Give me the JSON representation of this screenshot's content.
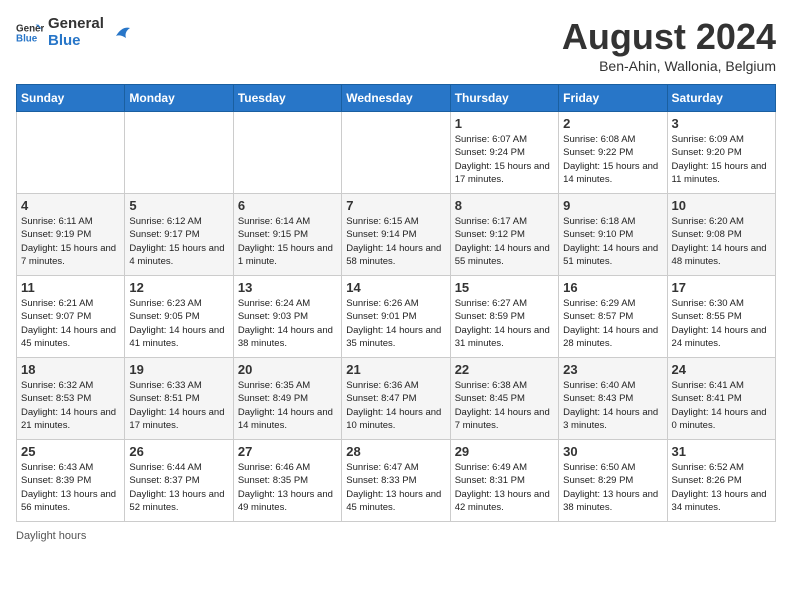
{
  "header": {
    "logo_line1": "General",
    "logo_line2": "Blue",
    "month_title": "August 2024",
    "subtitle": "Ben-Ahin, Wallonia, Belgium"
  },
  "days_of_week": [
    "Sunday",
    "Monday",
    "Tuesday",
    "Wednesday",
    "Thursday",
    "Friday",
    "Saturday"
  ],
  "weeks": [
    [
      {
        "day": "",
        "info": ""
      },
      {
        "day": "",
        "info": ""
      },
      {
        "day": "",
        "info": ""
      },
      {
        "day": "",
        "info": ""
      },
      {
        "day": "1",
        "info": "Sunrise: 6:07 AM\nSunset: 9:24 PM\nDaylight: 15 hours and 17 minutes."
      },
      {
        "day": "2",
        "info": "Sunrise: 6:08 AM\nSunset: 9:22 PM\nDaylight: 15 hours and 14 minutes."
      },
      {
        "day": "3",
        "info": "Sunrise: 6:09 AM\nSunset: 9:20 PM\nDaylight: 15 hours and 11 minutes."
      }
    ],
    [
      {
        "day": "4",
        "info": "Sunrise: 6:11 AM\nSunset: 9:19 PM\nDaylight: 15 hours and 7 minutes."
      },
      {
        "day": "5",
        "info": "Sunrise: 6:12 AM\nSunset: 9:17 PM\nDaylight: 15 hours and 4 minutes."
      },
      {
        "day": "6",
        "info": "Sunrise: 6:14 AM\nSunset: 9:15 PM\nDaylight: 15 hours and 1 minute."
      },
      {
        "day": "7",
        "info": "Sunrise: 6:15 AM\nSunset: 9:14 PM\nDaylight: 14 hours and 58 minutes."
      },
      {
        "day": "8",
        "info": "Sunrise: 6:17 AM\nSunset: 9:12 PM\nDaylight: 14 hours and 55 minutes."
      },
      {
        "day": "9",
        "info": "Sunrise: 6:18 AM\nSunset: 9:10 PM\nDaylight: 14 hours and 51 minutes."
      },
      {
        "day": "10",
        "info": "Sunrise: 6:20 AM\nSunset: 9:08 PM\nDaylight: 14 hours and 48 minutes."
      }
    ],
    [
      {
        "day": "11",
        "info": "Sunrise: 6:21 AM\nSunset: 9:07 PM\nDaylight: 14 hours and 45 minutes."
      },
      {
        "day": "12",
        "info": "Sunrise: 6:23 AM\nSunset: 9:05 PM\nDaylight: 14 hours and 41 minutes."
      },
      {
        "day": "13",
        "info": "Sunrise: 6:24 AM\nSunset: 9:03 PM\nDaylight: 14 hours and 38 minutes."
      },
      {
        "day": "14",
        "info": "Sunrise: 6:26 AM\nSunset: 9:01 PM\nDaylight: 14 hours and 35 minutes."
      },
      {
        "day": "15",
        "info": "Sunrise: 6:27 AM\nSunset: 8:59 PM\nDaylight: 14 hours and 31 minutes."
      },
      {
        "day": "16",
        "info": "Sunrise: 6:29 AM\nSunset: 8:57 PM\nDaylight: 14 hours and 28 minutes."
      },
      {
        "day": "17",
        "info": "Sunrise: 6:30 AM\nSunset: 8:55 PM\nDaylight: 14 hours and 24 minutes."
      }
    ],
    [
      {
        "day": "18",
        "info": "Sunrise: 6:32 AM\nSunset: 8:53 PM\nDaylight: 14 hours and 21 minutes."
      },
      {
        "day": "19",
        "info": "Sunrise: 6:33 AM\nSunset: 8:51 PM\nDaylight: 14 hours and 17 minutes."
      },
      {
        "day": "20",
        "info": "Sunrise: 6:35 AM\nSunset: 8:49 PM\nDaylight: 14 hours and 14 minutes."
      },
      {
        "day": "21",
        "info": "Sunrise: 6:36 AM\nSunset: 8:47 PM\nDaylight: 14 hours and 10 minutes."
      },
      {
        "day": "22",
        "info": "Sunrise: 6:38 AM\nSunset: 8:45 PM\nDaylight: 14 hours and 7 minutes."
      },
      {
        "day": "23",
        "info": "Sunrise: 6:40 AM\nSunset: 8:43 PM\nDaylight: 14 hours and 3 minutes."
      },
      {
        "day": "24",
        "info": "Sunrise: 6:41 AM\nSunset: 8:41 PM\nDaylight: 14 hours and 0 minutes."
      }
    ],
    [
      {
        "day": "25",
        "info": "Sunrise: 6:43 AM\nSunset: 8:39 PM\nDaylight: 13 hours and 56 minutes."
      },
      {
        "day": "26",
        "info": "Sunrise: 6:44 AM\nSunset: 8:37 PM\nDaylight: 13 hours and 52 minutes."
      },
      {
        "day": "27",
        "info": "Sunrise: 6:46 AM\nSunset: 8:35 PM\nDaylight: 13 hours and 49 minutes."
      },
      {
        "day": "28",
        "info": "Sunrise: 6:47 AM\nSunset: 8:33 PM\nDaylight: 13 hours and 45 minutes."
      },
      {
        "day": "29",
        "info": "Sunrise: 6:49 AM\nSunset: 8:31 PM\nDaylight: 13 hours and 42 minutes."
      },
      {
        "day": "30",
        "info": "Sunrise: 6:50 AM\nSunset: 8:29 PM\nDaylight: 13 hours and 38 minutes."
      },
      {
        "day": "31",
        "info": "Sunrise: 6:52 AM\nSunset: 8:26 PM\nDaylight: 13 hours and 34 minutes."
      }
    ]
  ],
  "footer": {
    "daylight_label": "Daylight hours"
  }
}
